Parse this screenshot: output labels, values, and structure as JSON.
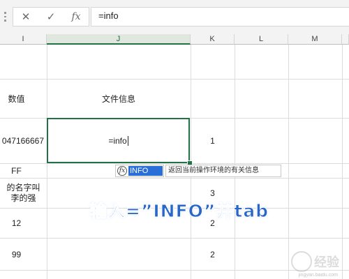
{
  "formula_bar": {
    "cancel_icon": "✕",
    "enter_icon": "✓",
    "fx_icon": "fx",
    "content": "=info"
  },
  "columns": [
    "I",
    "J",
    "K",
    "L",
    "M"
  ],
  "selected_column": "J",
  "cells": {
    "i_row2": "数值",
    "j_row2": "文件信息",
    "i_row3": "047166667",
    "j_row3": "=info",
    "k_row3": "1",
    "i_row4": "FF",
    "i_row5": "的名字叫\n李的强",
    "k_row5": "3",
    "i_row6": "12",
    "k_row6": "2",
    "i_row7": "99",
    "k_row7": "2"
  },
  "autocomplete": {
    "item": "INFO",
    "icon": "fx",
    "tooltip": "返回当前操作环境的有关信息"
  },
  "caption": "输入=”INFO”并tab",
  "watermark": {
    "text": "经验",
    "sub": "jingyan.baidu.com"
  },
  "colors": {
    "accent_green": "#217346",
    "autocomplete_blue": "#2a6ed8",
    "caption_blue": "#2a66c7"
  }
}
